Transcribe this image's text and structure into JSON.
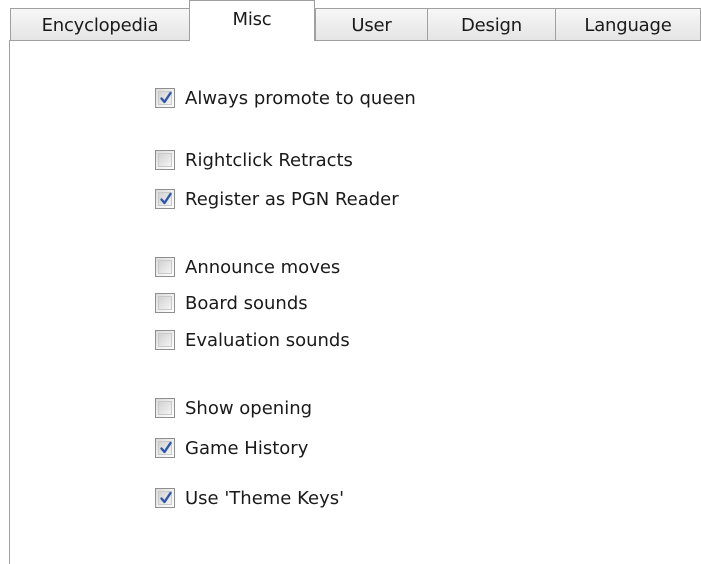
{
  "tabs": [
    {
      "label": "Encyclopedia",
      "active": false
    },
    {
      "label": "Misc",
      "active": true
    },
    {
      "label": "User",
      "active": false
    },
    {
      "label": "Design",
      "active": false
    },
    {
      "label": "Language",
      "active": false
    }
  ],
  "options": [
    {
      "label": "Always promote to queen",
      "checked": true
    },
    {
      "label": "Rightclick Retracts",
      "checked": false
    },
    {
      "label": "Register as PGN Reader",
      "checked": true
    },
    {
      "label": "Announce moves",
      "checked": false
    },
    {
      "label": "Board sounds",
      "checked": false
    },
    {
      "label": "Evaluation sounds",
      "checked": false
    },
    {
      "label": "Show opening",
      "checked": false
    },
    {
      "label": "Game History",
      "checked": true
    },
    {
      "label": "Use 'Theme Keys'",
      "checked": true
    }
  ],
  "colors": {
    "check_mark": "#2f57a8",
    "border": "#a0a0a0"
  }
}
